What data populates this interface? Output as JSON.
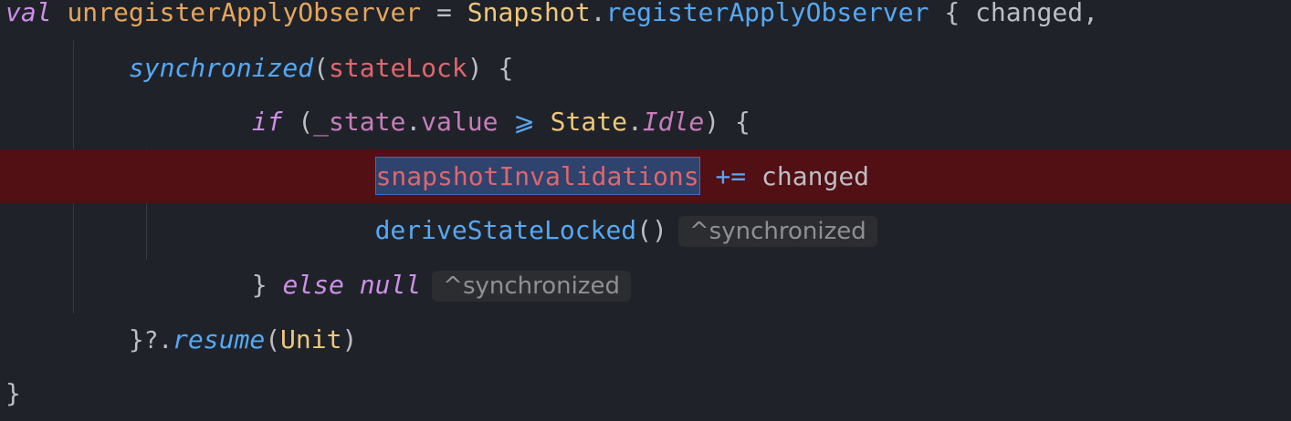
{
  "code": {
    "line1": {
      "kw_val": "val",
      "var_name": "unregisterApplyObserver",
      "assign": "=",
      "cls": "Snapshot",
      "dot": ".",
      "fn": "registerApplyObserver",
      "brace": "{",
      "param": "changed,"
    },
    "line2": {
      "fn": "synchronized",
      "open": "(",
      "arg": "stateLock",
      "close": ")",
      "brace": "{"
    },
    "line3": {
      "kw_if": "if",
      "open": "(",
      "prop": "_state",
      "dot": ".",
      "value": "value",
      "op": "⩾",
      "cls": "State",
      "dot2": ".",
      "enum": "Idle",
      "close": ")",
      "brace": "{"
    },
    "line4": {
      "var": "snapshotInvalidations",
      "op": "+=",
      "arg": "changed"
    },
    "line5": {
      "fn": "deriveStateLocked",
      "parens": "()",
      "hint": "^synchronized"
    },
    "line6": {
      "brace": "}",
      "kw_else": "else",
      "kw_null": "null",
      "hint": "^synchronized"
    },
    "line7": {
      "brace": "}",
      "safe": "?.",
      "fn": "resume",
      "open": "(",
      "arg": "Unit",
      "close": ")"
    },
    "line8": {
      "brace": "}"
    }
  },
  "colors": {
    "background": "#1f2329",
    "breakpoint_line": "#520f14",
    "selection": "#2e436e",
    "keyword": "#cf8ee8",
    "function": "#56a8f5",
    "class": "#efc77c",
    "variable_red": "#e0666c"
  }
}
